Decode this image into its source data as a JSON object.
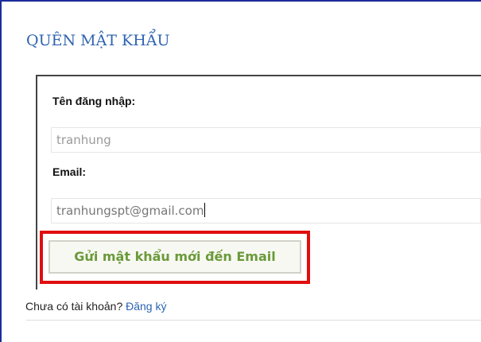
{
  "page": {
    "title": "QUÊN MẬT KHẨU"
  },
  "form": {
    "username_label": "Tên đăng nhập:",
    "username_value": "tranhung",
    "email_label": "Email:",
    "email_value": "tranhungspt@gmail.com",
    "submit_label": "Gửi mật khẩu mới đến Email"
  },
  "footer": {
    "prompt_text": "Chưa có tài khoản?",
    "register_link": "Đăng ký"
  },
  "colors": {
    "heading": "#2f63b1",
    "button_text": "#6a9a3a",
    "highlight_border": "#e10e0e",
    "frame_border": "#1c2c9c",
    "link": "#2a64b3"
  }
}
